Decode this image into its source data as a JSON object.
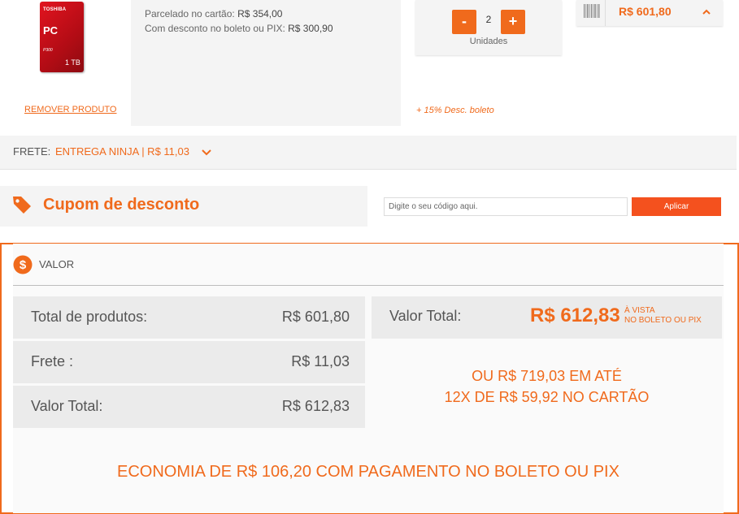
{
  "product": {
    "image": {
      "brand": "TOSHIBA",
      "line": "PC",
      "model": "P300",
      "capacity": "1 TB"
    },
    "remove_label": "REMOVER PRODUTO",
    "installment_label": "Parcelado no cartão:",
    "installment_value": "R$  354,00",
    "discount_label": "Com desconto no boleto ou PIX:",
    "discount_value": "R$  300,90",
    "quantity": "2",
    "quantity_label": "Unidades",
    "minus": "-",
    "plus": "+",
    "total": "R$  601,80",
    "discount_note": "+ 15% Desc. boleto"
  },
  "frete": {
    "label": "FRETE:",
    "value": "ENTREGA NINJA  |  R$  11,03"
  },
  "cupom": {
    "title": "Cupom de desconto",
    "placeholder": "Digite o seu código aqui.",
    "apply_label": "Aplicar"
  },
  "valor": {
    "title": "VALOR",
    "rows": [
      {
        "label": "Total de produtos:",
        "amount": "R$  601,80"
      },
      {
        "label": "Frete :",
        "amount": "R$  11,03"
      },
      {
        "label": "Valor Total:",
        "amount": "R$  612,83"
      }
    ],
    "total_label": "Valor Total:",
    "total_amount": "R$  612,83",
    "total_note_line1": "À VISTA",
    "total_note_line2": "NO BOLETO OU PIX",
    "installments_line1": "OU R$  719,03 EM ATÉ",
    "installments_line2": "12X DE R$  59,92 NO CARTÃO",
    "economy": "ECONOMIA DE R$  106,20 COM PAGAMENTO NO BOLETO OU PIX"
  },
  "colors": {
    "accent": "#f06a1c",
    "panel": "#f4f4f4",
    "row": "#ebebeb"
  }
}
